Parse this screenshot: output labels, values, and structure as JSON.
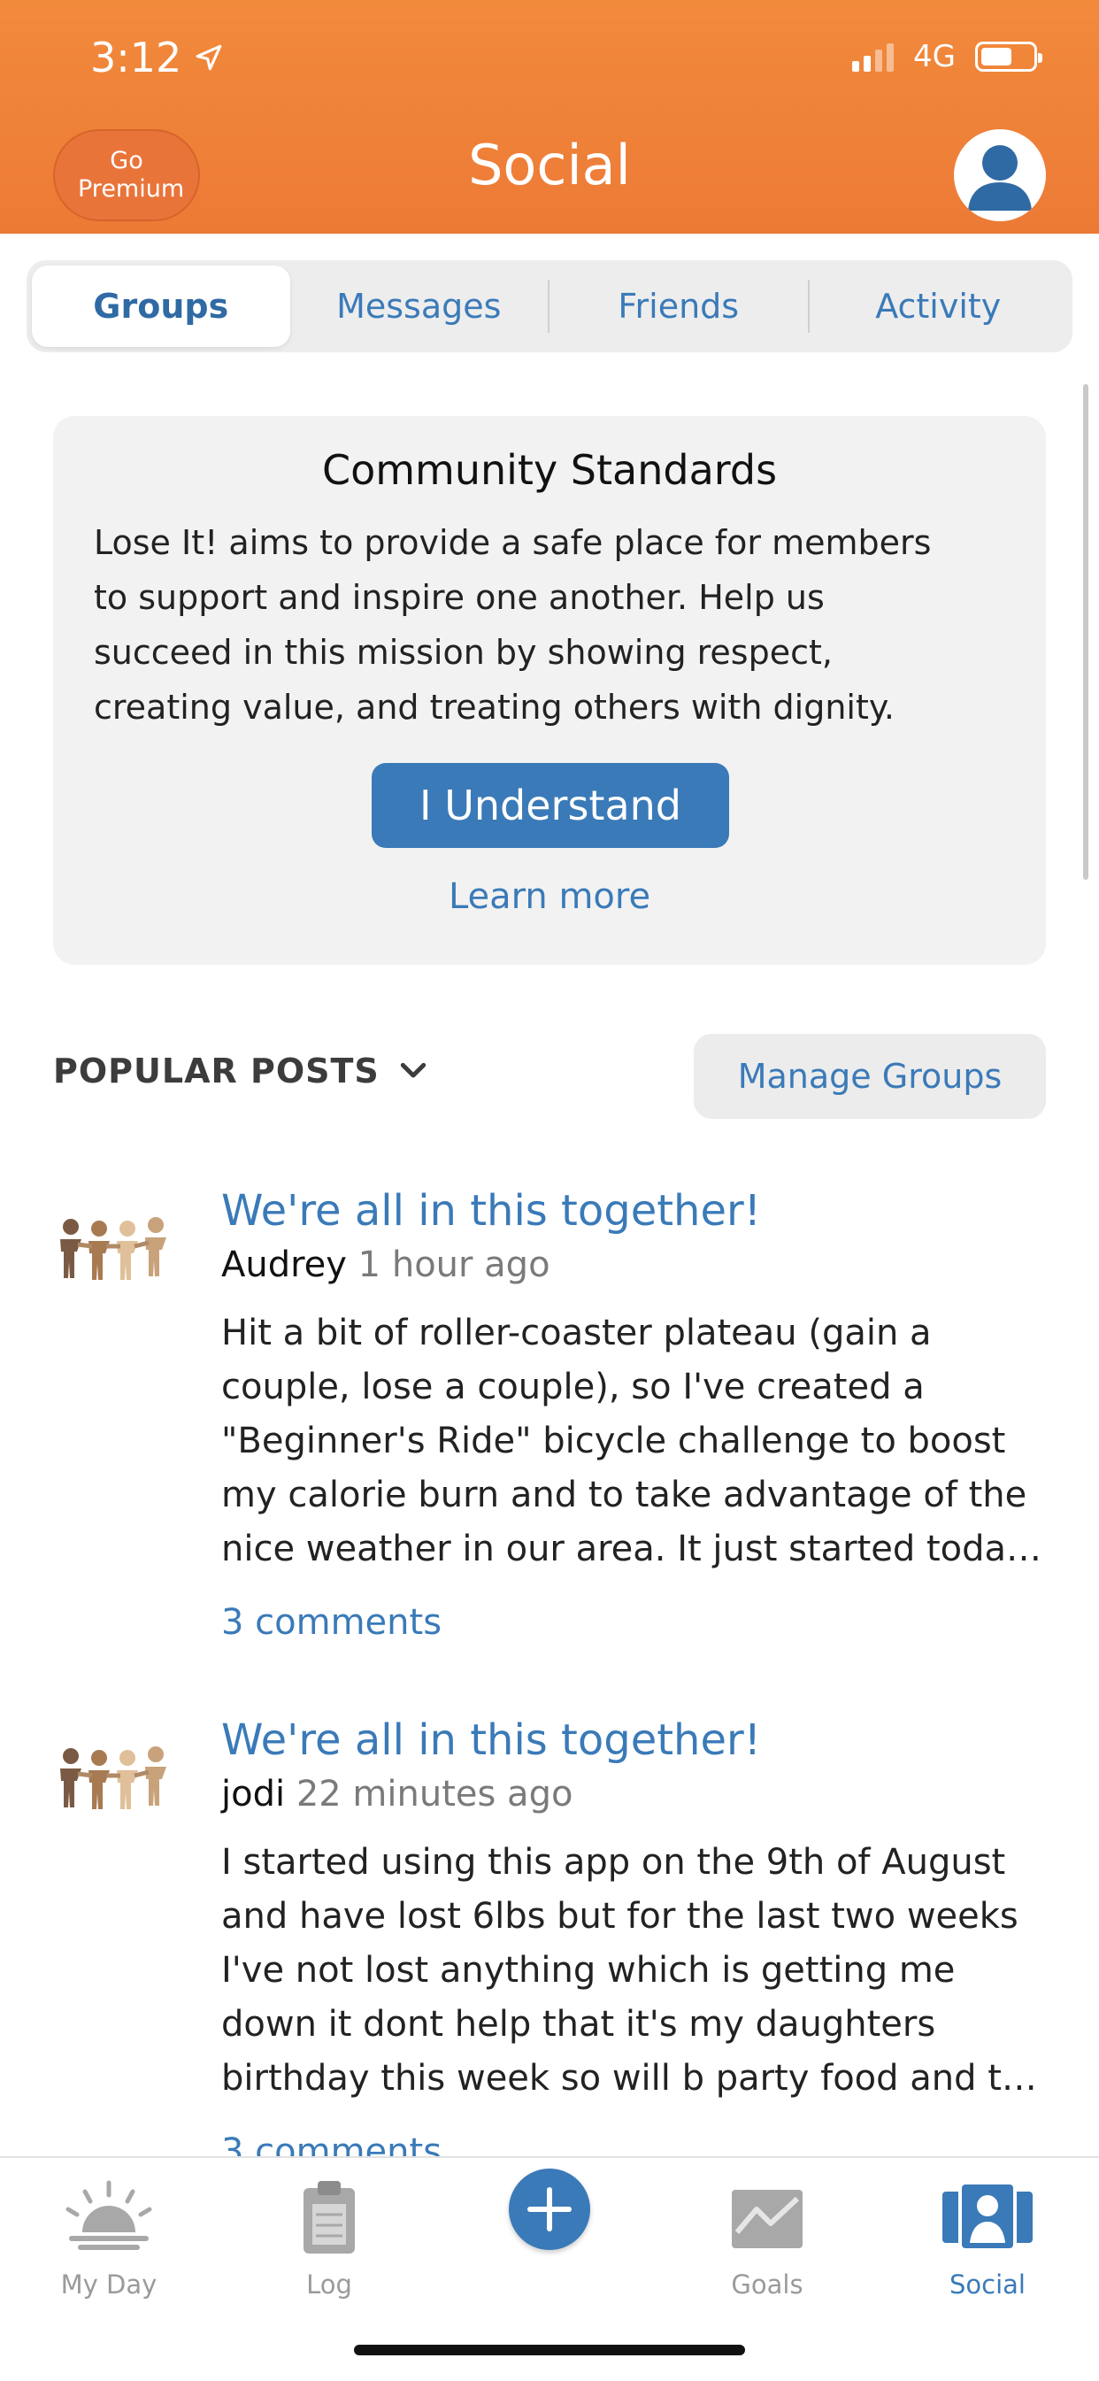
{
  "status_bar": {
    "time": "3:12",
    "network": "4G"
  },
  "header": {
    "premium_label": "Go Premium",
    "title": "Social"
  },
  "tabs": [
    {
      "label": "Groups",
      "active": true
    },
    {
      "label": "Messages",
      "active": false
    },
    {
      "label": "Friends",
      "active": false
    },
    {
      "label": "Activity",
      "active": false
    }
  ],
  "standards": {
    "title": "Community Standards",
    "lines": [
      "Lose It! aims to provide a safe place for members",
      "to support and inspire one another. Help us",
      "succeed in this mission by showing respect,",
      "creating value, and treating others with dignity."
    ],
    "button_label": "I Understand",
    "learn_more": "Learn more"
  },
  "posts_section": {
    "filter_label": "POPULAR POSTS",
    "manage_label": "Manage Groups"
  },
  "posts": [
    {
      "title": "We're all in this together!",
      "author": "Audrey",
      "time": "1 hour ago",
      "lines": [
        "Hit a bit of roller-coaster plateau (gain a",
        "couple, lose a couple), so I've created a",
        "\"Beginner's Ride\" bicycle challenge to boost",
        "my calorie burn and to take advantage of the",
        "nice weather in our area. It just started toda…"
      ],
      "comments": "3 comments"
    },
    {
      "title": "We're all in this together!",
      "author": "jodi",
      "time": "22 minutes ago",
      "lines": [
        "I started using this app on the 9th of August",
        "and have lost 6lbs but for the last two weeks",
        "I've not lost anything which is getting me",
        "down it dont help that it's my daughters",
        "birthday this week so will b party food and t…"
      ],
      "comments": "3 comments"
    }
  ],
  "tabbar": {
    "items": [
      {
        "label": "My Day",
        "icon": "sunrise-icon"
      },
      {
        "label": "Log",
        "icon": "clipboard-icon"
      },
      {
        "label": "Goals",
        "icon": "chart-icon"
      },
      {
        "label": "Social",
        "icon": "people-icon"
      }
    ],
    "active": "Social",
    "accent": "#3a7ab8"
  },
  "colors": {
    "header_orange": "#ee7f38",
    "accent_blue": "#3a7ab8"
  }
}
